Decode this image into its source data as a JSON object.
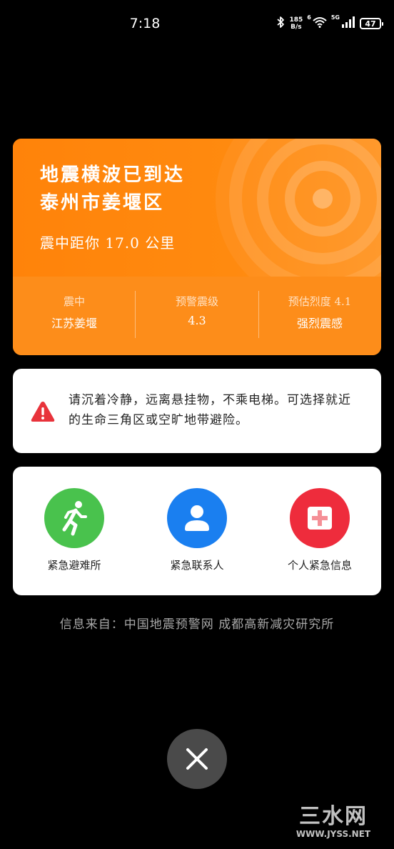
{
  "status_bar": {
    "time": "7:18",
    "net_speed_value": "185",
    "net_speed_unit": "B/s",
    "wifi_tag": "6",
    "signal_tag": "5G",
    "battery_level": "47"
  },
  "alert": {
    "title_line1": "地震横波已到达",
    "title_line2": "泰州市姜堰区",
    "distance": "震中距你 17.0 公里",
    "stats": [
      {
        "label": "震中",
        "value": "江苏姜堰"
      },
      {
        "label": "预警震级",
        "value": "4.3"
      },
      {
        "label": "预估烈度 4.1",
        "value": "强烈震感"
      }
    ],
    "colors": {
      "card": "#ff8a0d",
      "stats_band": "#fd8d1a"
    }
  },
  "advice": {
    "text": "请沉着冷静，远离悬挂物，不乘电梯。可选择就近的生命三角区或空旷地带避险。",
    "icon": "warning-icon",
    "icon_color": "#e8333b"
  },
  "actions": [
    {
      "label": "紧急避难所",
      "icon": "running-person-icon",
      "color": "#49c24d"
    },
    {
      "label": "紧急联系人",
      "icon": "person-icon",
      "color": "#1a7ff0"
    },
    {
      "label": "个人紧急信息",
      "icon": "medical-cross-icon",
      "color": "#ee2c3c"
    }
  ],
  "source": "信息来自：中国地震预警网 成都高新减灾研究所",
  "close": {
    "icon": "close-icon"
  },
  "watermark": {
    "logo": "三水网",
    "url": "WWW.JYSS.NET"
  }
}
